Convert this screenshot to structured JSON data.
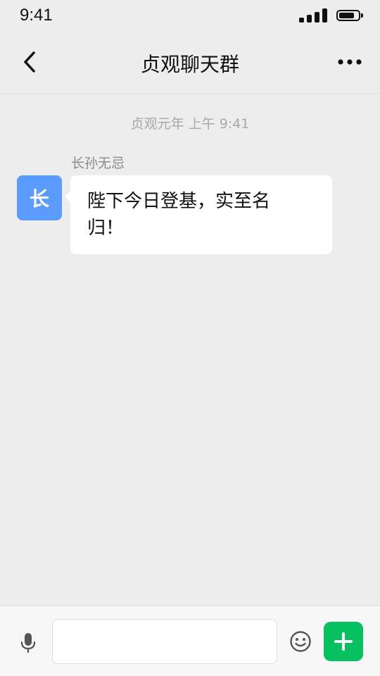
{
  "status_bar": {
    "time": "9:41",
    "signal_icon": "signal-bars-icon",
    "battery_icon": "battery-icon",
    "battery_level": 0.8
  },
  "nav": {
    "title": "贞观聊天群",
    "back_icon": "chevron-left-icon",
    "more_icon": "more-dots-icon"
  },
  "chat": {
    "timestamp": "贞观元年 上午 9:41",
    "messages": [
      {
        "sender": "长孙无忌",
        "avatar_text": "长",
        "avatar_color": "#5b9bfe",
        "text": "陛下今日登基，实至名归！"
      }
    ]
  },
  "input_bar": {
    "voice_icon": "microphone-icon",
    "input_value": "",
    "input_placeholder": "",
    "emoji_icon": "smiley-icon",
    "plus_icon": "plus-icon",
    "plus_color": "#07c160"
  }
}
